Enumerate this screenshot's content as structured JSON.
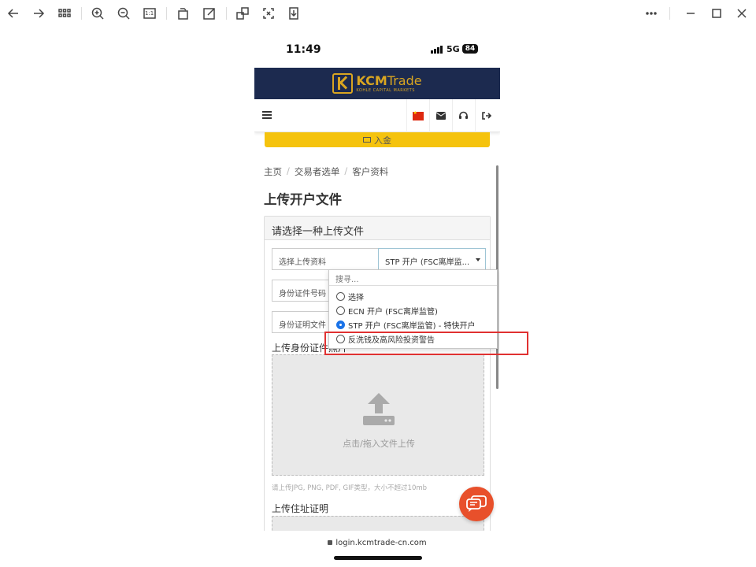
{
  "toolbar": {
    "icons": [
      "back-arrow-icon",
      "forward-arrow-icon",
      "grid-icon",
      "zoom-in-icon",
      "zoom-out-icon",
      "actual-size-icon",
      "rotate-icon",
      "edit-icon",
      "crop-icon",
      "fit-icon",
      "download-icon",
      "more-icon",
      "minimize-icon",
      "maximize-icon",
      "close-icon"
    ],
    "actual_size_label": "1:1"
  },
  "status_bar": {
    "time": "11:49",
    "network": "5G",
    "battery": "84"
  },
  "brand": {
    "name_bold": "KCM",
    "name_light": "Trade",
    "tagline": "KOHLE CAPITAL MARKETS",
    "color": "#d9a521",
    "bar_color": "#1c2a4f"
  },
  "nav": {
    "icons": [
      "menu-icon",
      "china-flag-icon",
      "mail-icon",
      "support-icon",
      "logout-icon"
    ]
  },
  "deposit": {
    "label": "入金",
    "color": "#f5c30e"
  },
  "breadcrumb": {
    "items": [
      "主页",
      "交易者选单",
      "客户资料"
    ],
    "separator": "/"
  },
  "page_title": "上传开户文件",
  "panel": {
    "heading": "请选择一种上传文件",
    "select_label": "选择上传资料",
    "select_value": "STP 开户 (FSC离岸监...",
    "id_number_label": "身份证件号码",
    "id_doc_label": "身份证明文件",
    "upload_id_label": "上传身份证件照片",
    "dropzone_text": "点击/拖入文件上传",
    "hint": "请上传JPG, PNG, PDF, GIF类型，大小不超过10mb",
    "upload_address_label": "上传住址证明"
  },
  "dropdown": {
    "search_placeholder": "搜寻...",
    "options": [
      {
        "label": "选择",
        "selected": false
      },
      {
        "label": "ECN 开户 (FSC离岸监管)",
        "selected": false
      },
      {
        "label": "STP 开户 (FSC离岸监管) - 特快开户",
        "selected": true
      },
      {
        "label": "反洗钱及高风险投资警告",
        "selected": false
      }
    ],
    "highlight_color": "#e03131"
  },
  "url": "login.kcmtrade-cn.com"
}
